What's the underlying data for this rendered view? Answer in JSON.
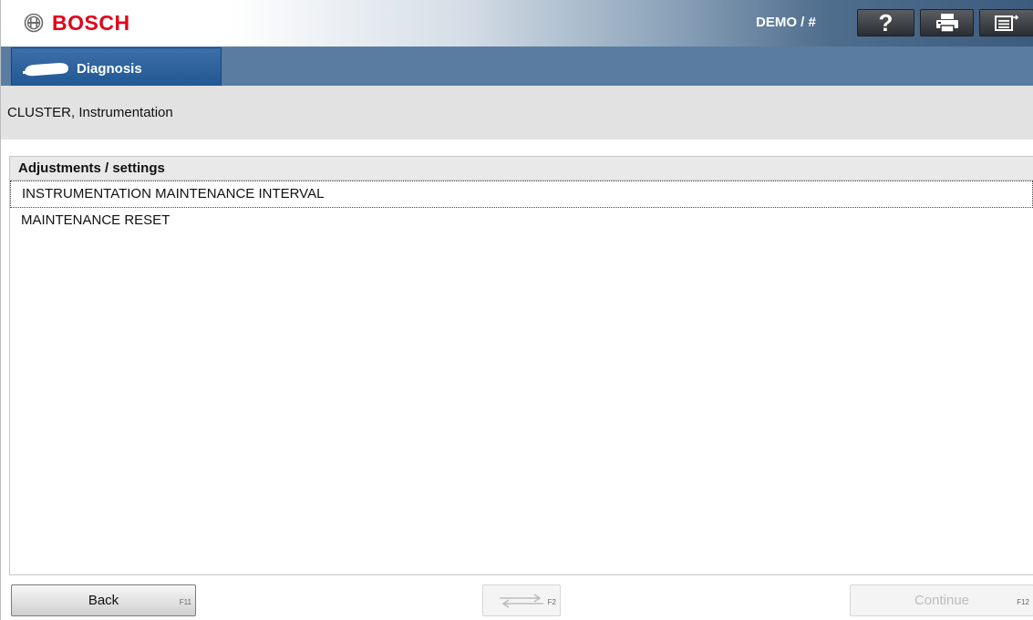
{
  "header": {
    "brand": "BOSCH",
    "user": "DEMO / #",
    "help_label": "?",
    "icons": [
      "bosch-logo-icon",
      "help-icon",
      "printer-icon",
      "menu-icon"
    ]
  },
  "tabs": [
    {
      "label": "Diagnosis",
      "icon": "plug-icon",
      "active": true
    }
  ],
  "page_title": "CLUSTER, Instrumentation",
  "list": {
    "header": "Adjustments / settings",
    "items": [
      {
        "label": "INSTRUMENTATION MAINTENANCE INTERVAL",
        "selected": true
      },
      {
        "label": "MAINTENANCE RESET",
        "selected": false
      }
    ]
  },
  "footer": {
    "back": {
      "label": "Back",
      "key": "F11"
    },
    "swap": {
      "key": "F2",
      "icon": "swap-arrows-icon"
    },
    "continue": {
      "label": "Continue",
      "key": "F12"
    }
  },
  "colors": {
    "brand_red": "#e2001a",
    "tab_blue": "#1e5592",
    "tabstrip": "#5a7ca0",
    "title_gray": "#e2e2e2"
  }
}
